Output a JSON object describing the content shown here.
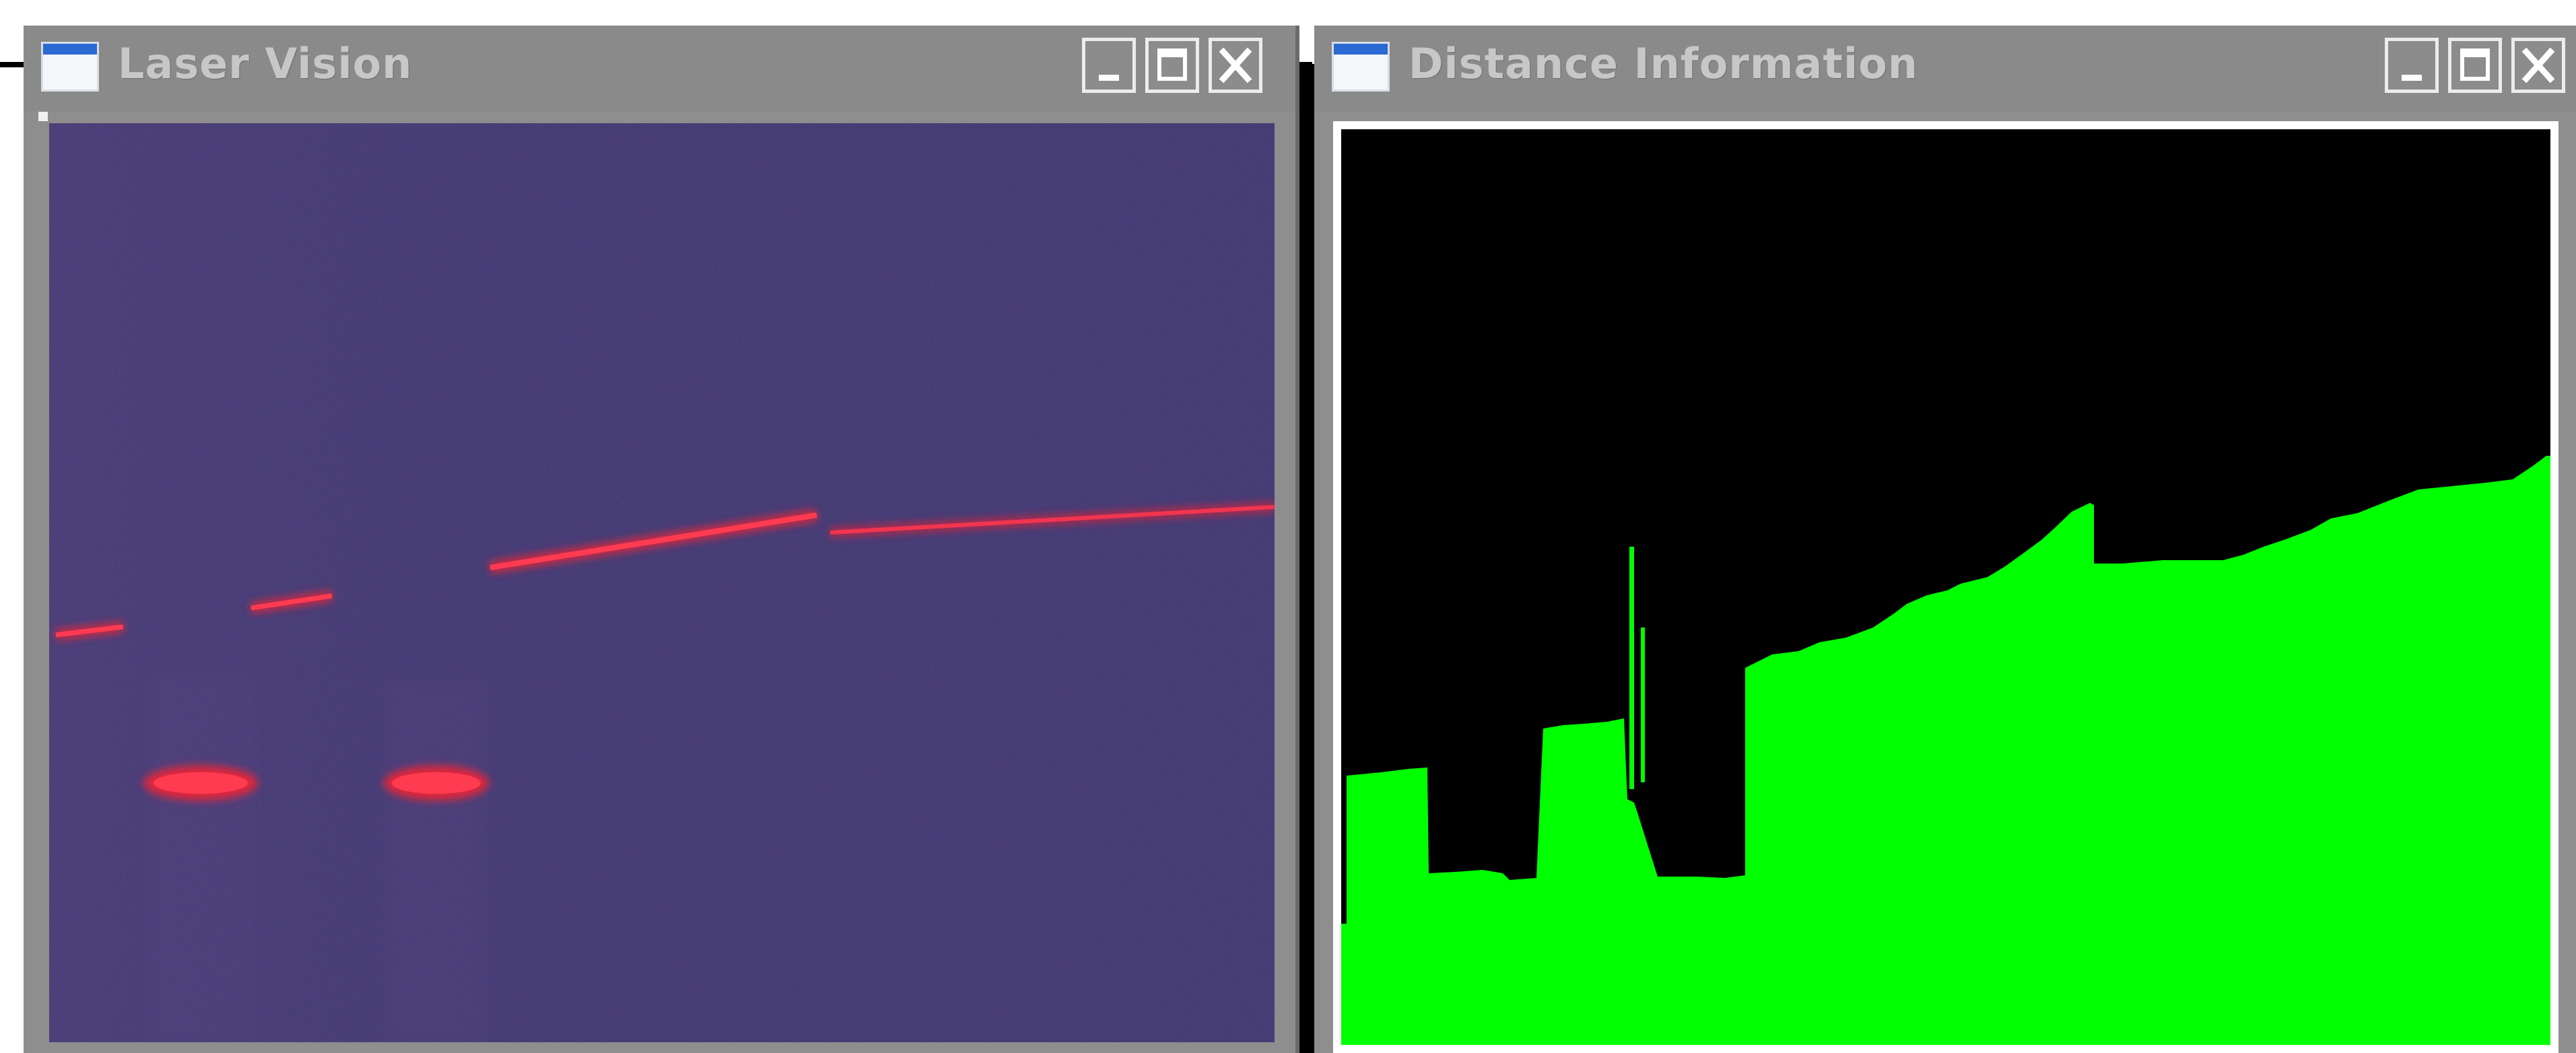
{
  "windows": {
    "left": {
      "title": "Laser Vision",
      "icon": "window-app-icon",
      "controls": {
        "minimize": "minimize-icon",
        "maximize": "maximize-icon",
        "close": "close-icon"
      }
    },
    "right": {
      "title": "Distance Information",
      "icon": "window-app-icon",
      "controls": {
        "minimize": "minimize-icon",
        "maximize": "maximize-icon",
        "close": "close-icon"
      }
    }
  },
  "colors": {
    "camera_background": "#0b0f2e",
    "laser_line": "#e0253a",
    "distance_fill": "#00ff00",
    "distance_background": "#000000",
    "window_frame": "#8e8e8e"
  }
}
